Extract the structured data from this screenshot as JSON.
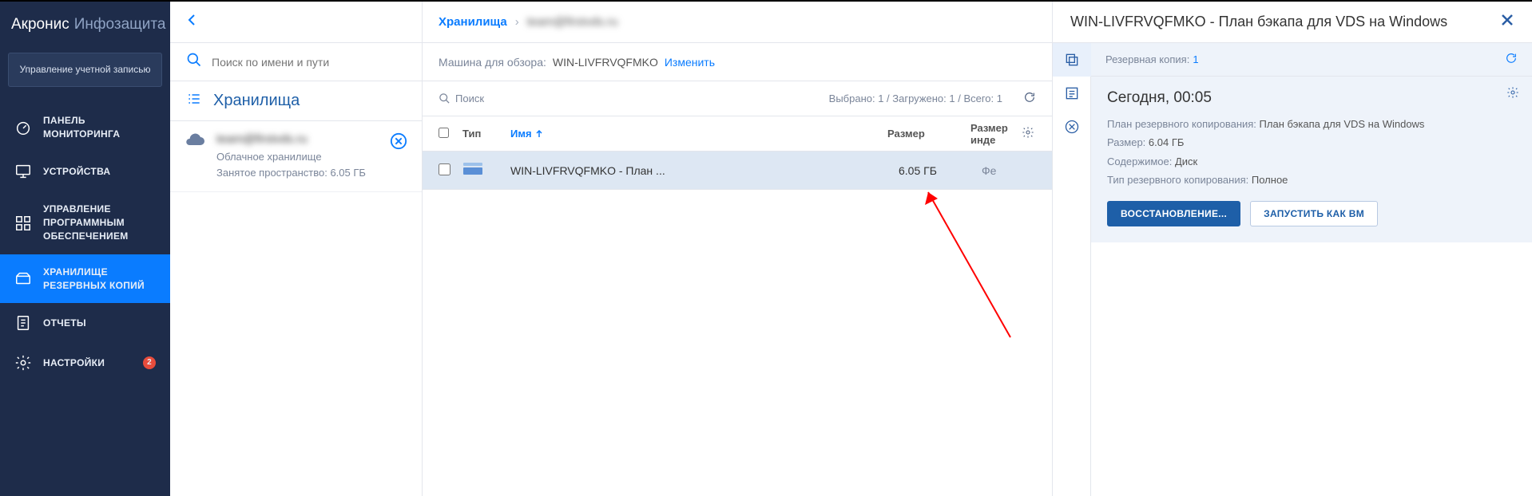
{
  "brand": {
    "main": "Акронис",
    "sub": "Инфозащита"
  },
  "account_button": "Управление учетной записью",
  "nav": {
    "monitoring": "ПАНЕЛЬ МОНИТОРИНГА",
    "devices": "УСТРОЙСТВА",
    "software": "УПРАВЛЕНИЕ ПРОГРАММНЫМ ОБЕСПЕЧЕНИЕМ",
    "storage": "ХРАНИЛИЩЕ РЕЗЕРВНЫХ КОПИЙ",
    "reports": "ОТЧЕТЫ",
    "settings": "НАСТРОЙКИ",
    "settings_badge": "2"
  },
  "storage_col": {
    "search_placeholder": "Поиск по имени и пути",
    "title": "Хранилища",
    "item": {
      "name": "team@firstvds.ru",
      "line1": "Облачное хранилище",
      "line2": "Занятое пространство: 6.05 ГБ"
    }
  },
  "main": {
    "breadcrumb": {
      "root": "Хранилища",
      "current": "team@firstvds.ru"
    },
    "machine": {
      "label": "Машина для обзора:",
      "value": "WIN-LIVFRVQFMKO",
      "change": "Изменить"
    },
    "filter": {
      "search": "Поиск",
      "stats": "Выбрано: 1 / Загружено: 1 / Всего: 1"
    },
    "head": {
      "type": "Тип",
      "name": "Имя",
      "size": "Размер",
      "index": "Размер инде"
    },
    "row": {
      "name": "WIN-LIVFRVQFMKO - План ...",
      "size": "6.05 ГБ",
      "date": "Фе"
    }
  },
  "panel": {
    "title": "WIN-LIVFRVQFMKO - План бэкапа для VDS на Windows",
    "rev_label": "Резервная копия:",
    "rev_count": "1",
    "backup": {
      "time": "Сегодня, 00:05",
      "plan_label": "План резервного копирования:",
      "plan_value": "План бэкапа для VDS на Windows",
      "size_label": "Размер:",
      "size_value": "6.04 ГБ",
      "content_label": "Содержимое:",
      "content_value": "Диск",
      "type_label": "Тип резервного копирования:",
      "type_value": "Полное",
      "btn_restore": "ВОССТАНОВЛЕНИЕ...",
      "btn_run_vm": "ЗАПУСТИТЬ КАК ВМ"
    }
  }
}
